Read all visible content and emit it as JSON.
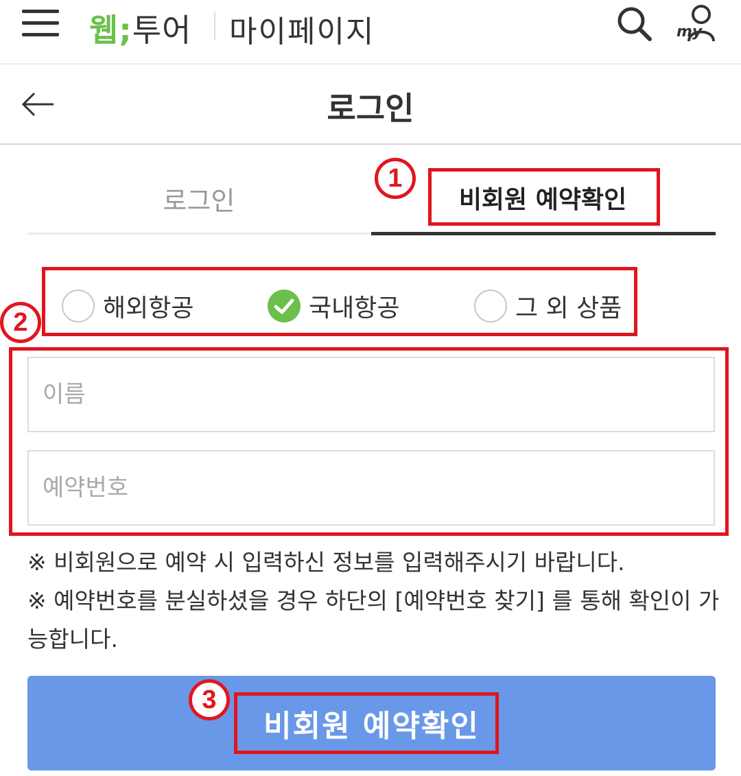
{
  "topbar": {
    "logo_web": "웹",
    "logo_sep": ";",
    "logo_tour": "투어",
    "section": "마이페이지",
    "my_label": "my"
  },
  "header": {
    "title": "로그인"
  },
  "tabs": [
    {
      "label": "로그인",
      "active": false
    },
    {
      "label": "비회원 예약확인",
      "active": true
    }
  ],
  "radios": [
    {
      "label": "해외항공",
      "checked": false
    },
    {
      "label": "국내항공",
      "checked": true
    },
    {
      "label": "그 외 상품",
      "checked": false
    }
  ],
  "inputs": {
    "name_placeholder": "이름",
    "reservation_placeholder": "예약번호"
  },
  "notes": [
    "※ 비회원으로 예약 시 입력하신 정보를 입력해주시기 바랍니다.",
    "※ 예약번호를 분실하셨을 경우 하단의 [예약번호 찾기] 를 통해 확인이 가능합니다."
  ],
  "submit_label": "비회원 예약확인",
  "annotations": {
    "badge1": "1",
    "badge2": "2",
    "badge3": "3"
  },
  "colors": {
    "brand_green": "#6bbf4a",
    "button_blue": "#6a98e8",
    "annotation_red": "#e0161e"
  }
}
